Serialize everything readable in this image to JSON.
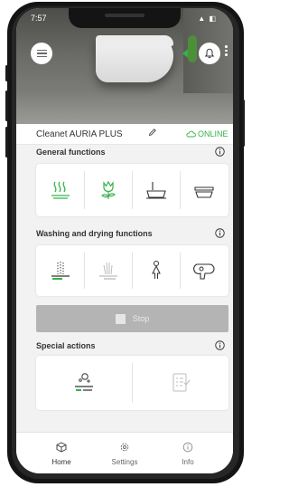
{
  "status_bar": {
    "time": "7:57",
    "indicators": "▲ ◧"
  },
  "header": {
    "menu_icon": "hamburger-menu-icon",
    "bell_icon": "bell-icon",
    "more_icon": "vertical-dots-icon"
  },
  "device": {
    "name": "Cleanet AURIA PLUS",
    "status": "ONLINE",
    "status_color": "#35b24a"
  },
  "sections": {
    "general": {
      "title": "General functions",
      "items": [
        {
          "icon": "heated-seat-icon",
          "active": true
        },
        {
          "icon": "flower-scent-icon",
          "active": true
        },
        {
          "icon": "lid-open-icon",
          "active": false
        },
        {
          "icon": "lid-closed-icon",
          "active": false
        }
      ]
    },
    "washing": {
      "title": "Washing and drying functions",
      "items": [
        {
          "icon": "rear-wash-icon",
          "active": false
        },
        {
          "icon": "lady-wash-icon",
          "active": false,
          "disabled": true
        },
        {
          "icon": "user-person-icon",
          "active": false
        },
        {
          "icon": "dryer-icon",
          "active": false
        }
      ]
    },
    "stop": {
      "label": "Stop"
    },
    "special": {
      "title": "Special actions",
      "items": [
        {
          "icon": "descaling-icon",
          "active": false
        },
        {
          "icon": "checklist-icon",
          "active": false,
          "disabled": true
        }
      ]
    }
  },
  "nav": {
    "items": [
      {
        "label": "Home",
        "icon": "cube-home-icon",
        "active": true
      },
      {
        "label": "Settings",
        "icon": "gear-icon",
        "active": false
      },
      {
        "label": "Info",
        "icon": "info-icon",
        "active": false
      }
    ]
  },
  "colors": {
    "accent": "#35b24a",
    "disabled": "#b4b4b4"
  }
}
